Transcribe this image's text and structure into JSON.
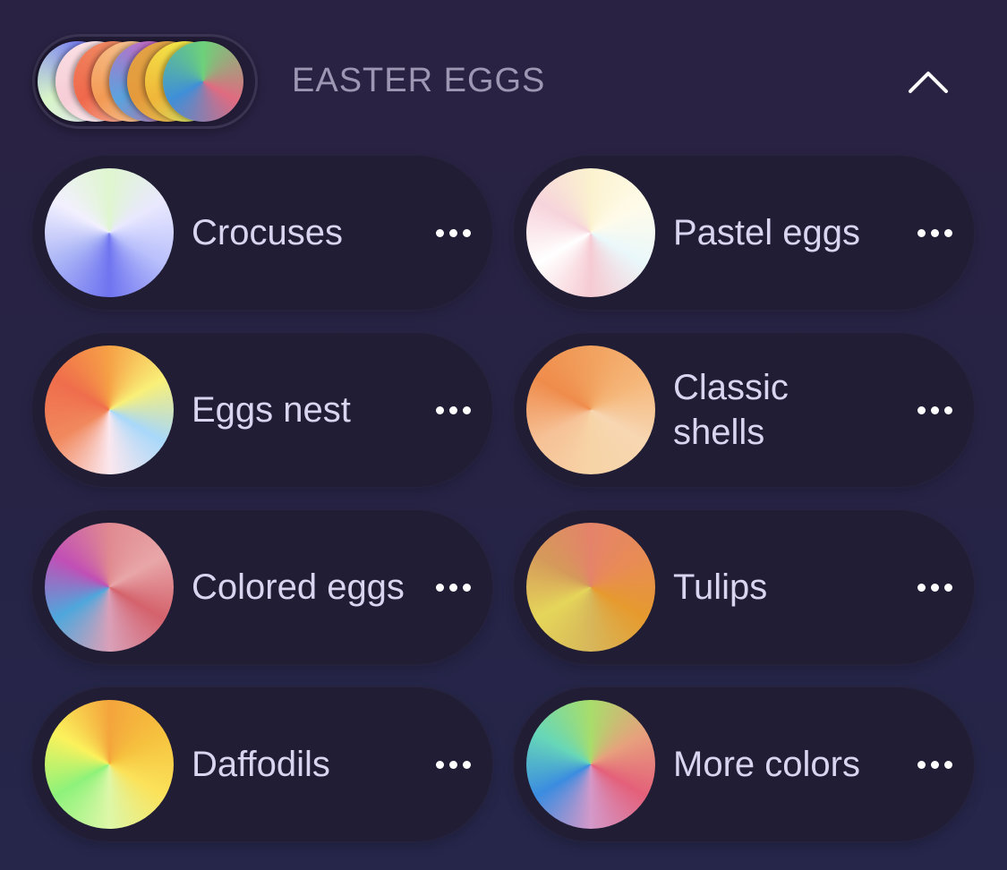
{
  "section": {
    "title": "EASTER EGGS",
    "collapse_icon": "chevron-up-icon",
    "preview_palettes": [
      [
        "#7b83f2",
        "#e6e4ff",
        "#d7f5c8"
      ],
      [
        "#fbe3e6",
        "#ffffff",
        "#f6cdd6"
      ],
      [
        "#f08a62",
        "#f6d2b6",
        "#f0684c"
      ],
      [
        "#f7c28f",
        "#f6d8b8",
        "#f39a54"
      ],
      [
        "#c16cc6",
        "#e0648e",
        "#5aa3de"
      ],
      [
        "#e0a446",
        "#e5d95a",
        "#e59a3c"
      ],
      [
        "#f4e949",
        "#b9f27a",
        "#f0b63a"
      ],
      [
        "#6dd17a",
        "#e06b80",
        "#3f8fd8"
      ]
    ]
  },
  "palettes": [
    {
      "label": "Crocuses",
      "more_icon": "more-dots-icon",
      "colors": [
        "#dff6cf",
        "#e9e8ff",
        "#b9c0fb",
        "#6f74f0",
        "#aab4f6",
        "#f2f0ff",
        "#dff6cf"
      ]
    },
    {
      "label": "Pastel eggs",
      "more_icon": "more-dots-icon",
      "colors": [
        "#fbf2cf",
        "#fffbe9",
        "#eaf8fb",
        "#f6cbd3",
        "#ffffff",
        "#f7d4dc",
        "#fbf2cf"
      ]
    },
    {
      "label": "Eggs nest",
      "more_icon": "more-dots-icon",
      "colors": [
        "#f6a146",
        "#f9f078",
        "#a8d8fa",
        "#fbe7ee",
        "#f1895e",
        "#ef6d4c",
        "#f6a146"
      ]
    },
    {
      "label": "Classic shells",
      "more_icon": "more-dots-icon",
      "colors": [
        "#f2a15e",
        "#f5b77a",
        "#f7d6b2",
        "#f7d4a6",
        "#f6c196",
        "#ef8c4c",
        "#f2a15e"
      ]
    },
    {
      "label": "Colored eggs",
      "more_icon": "more-dots-icon",
      "colors": [
        "#e08a90",
        "#e8a6a8",
        "#d4626c",
        "#d9a0b8",
        "#4ea7dc",
        "#c14fb6",
        "#e08a90"
      ]
    },
    {
      "label": "Tulips",
      "more_icon": "more-dots-icon",
      "colors": [
        "#e4836a",
        "#e88c55",
        "#e69a2e",
        "#d7b75a",
        "#e5d65a",
        "#d59a5a",
        "#e4836a"
      ]
    },
    {
      "label": "Daffodils",
      "more_icon": "more-dots-icon",
      "colors": [
        "#f4a53c",
        "#f6c23e",
        "#fbe25a",
        "#ddf7a8",
        "#8df27a",
        "#fbf25c",
        "#f4a53c"
      ]
    },
    {
      "label": "More colors",
      "more_icon": "more-dots-icon",
      "colors": [
        "#a8dd6b",
        "#e7a07d",
        "#e4607a",
        "#d399c9",
        "#3b8ce0",
        "#67d7b8",
        "#a8dd6b"
      ]
    }
  ]
}
